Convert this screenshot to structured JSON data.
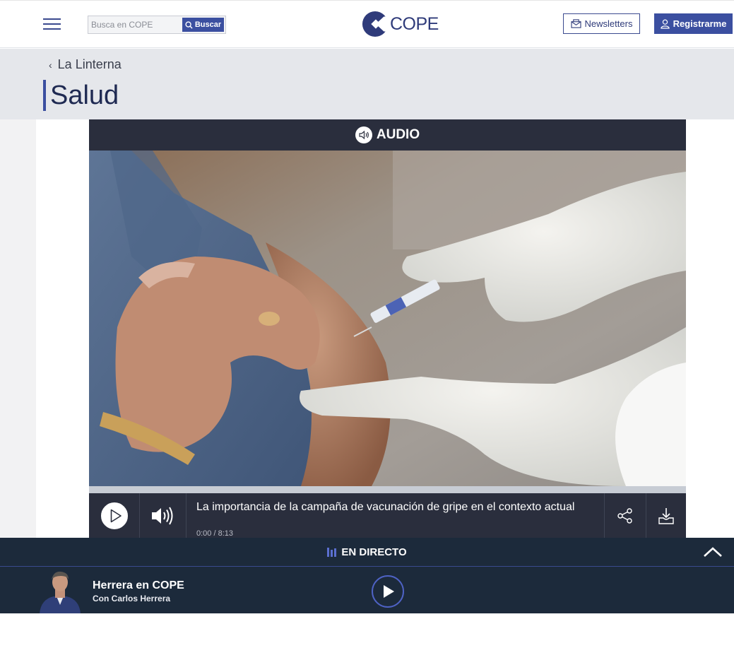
{
  "header": {
    "search_placeholder": "Busca en COPE",
    "search_button": "Buscar",
    "logo_text": "COPE",
    "newsletters_button": "Newsletters",
    "register_button": "Registrarme"
  },
  "section": {
    "breadcrumb": "La Linterna",
    "title": "Salud"
  },
  "audio_header": {
    "label": "AUDIO"
  },
  "player": {
    "title": "La importancia de la campaña de vacunación de gripe en el contexto actual",
    "time": "0:00 / 8:13",
    "progress": 0
  },
  "live": {
    "label": "EN DIRECTO",
    "show_title": "Herrera en COPE",
    "show_subtitle": "Con Carlos Herrera"
  },
  "colors": {
    "brand": "#3b4fa0",
    "navy": "#2f3b7a",
    "player_bg": "#2a2e3d",
    "live_bg": "#1c2a3b",
    "section_bg": "#e5e7eb"
  },
  "icons": {
    "menu": "hamburger-icon",
    "search": "search-icon",
    "newsletter": "envelope-icon",
    "register": "user-icon",
    "audio": "speaker-icon",
    "play": "play-icon",
    "volume": "volume-icon",
    "share": "share-icon",
    "download": "download-icon",
    "live": "live-bars-icon",
    "collapse": "chevron-up-icon"
  }
}
